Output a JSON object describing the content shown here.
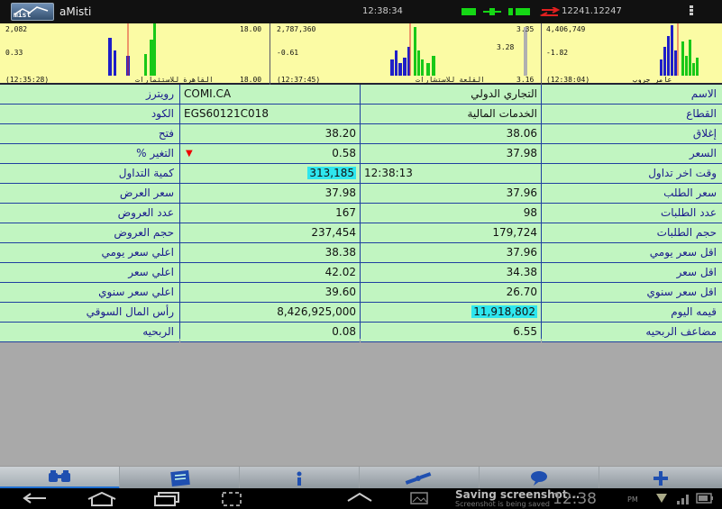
{
  "app": {
    "name": "aMisti",
    "logo_text": "mist",
    "logo_icon": "chart-line-icon"
  },
  "status": {
    "time": "12:38:34",
    "sequence": "12241.12247",
    "indicator_color": "#15d815",
    "transfer_color": "#e02020"
  },
  "mini_charts": [
    {
      "top_left": "2,082",
      "top_right": "18.00",
      "mid_left": "0.33",
      "bottom_left": "(12:35:28)",
      "bottom_right": "18.00",
      "name": "القاهرة للاستثمارات"
    },
    {
      "top_left": "2,787,360",
      "top_right": "3.35",
      "mid_left": "-0.61",
      "mid_right": "3.28",
      "bottom_left": "(12:37:45)",
      "bottom_right": "3.16",
      "name": "القلعة للاستشارات"
    },
    {
      "top_left": "4,406,749",
      "mid_left": "-1.82",
      "bottom_left": "(12:38:04)",
      "name": "عامر جروب"
    }
  ],
  "table": {
    "rows": [
      {
        "l_label": "رويترز",
        "l_value": "COMI.CA",
        "r_value": "التجاري الدولي",
        "r_label": "الاسم"
      },
      {
        "l_label": "الكود",
        "l_value": "EGS60121C018",
        "r_value": "الخدمات المالية",
        "r_label": "القطاع"
      },
      {
        "l_label": "فتح",
        "l_value": "38.20",
        "r_value": "38.06",
        "r_label": "إغلاق"
      },
      {
        "l_label": "% التغير",
        "l_value": "0.58",
        "r_value": "37.98",
        "r_label": "السعر"
      },
      {
        "l_label": "كمية التداول",
        "l_value": "313,185",
        "r_value": "12:38:13",
        "r_label": "وقت اخر تداول"
      },
      {
        "l_label": "سعر العرض",
        "l_value": "37.98",
        "r_value": "37.96",
        "r_label": "سعر الطلب"
      },
      {
        "l_label": "عدد العروض",
        "l_value": "167",
        "r_value": "98",
        "r_label": "عدد الطلبات"
      },
      {
        "l_label": "حجم العروض",
        "l_value": "237,454",
        "r_value": "179,724",
        "r_label": "حجم الطلبات"
      },
      {
        "l_label": "اعلي سعر يومي",
        "l_value": "38.38",
        "r_value": "37.96",
        "r_label": "اقل سعر يومي"
      },
      {
        "l_label": "اعلي سعر",
        "l_value": "42.02",
        "r_value": "34.38",
        "r_label": "اقل سعر"
      },
      {
        "l_label": "اعلي سعر سنوي",
        "l_value": "39.60",
        "r_value": "26.70",
        "r_label": "اقل سعر سنوي"
      },
      {
        "l_label": "رأس المال السوقي",
        "l_value": "8,426,925,000",
        "r_value": "11,918,802",
        "r_label": "قيمه اليوم"
      },
      {
        "l_label": "الربحيه",
        "l_value": "0.08",
        "r_value": "6.55",
        "r_label": "مضاعف الربحيه"
      }
    ]
  },
  "toolbar": {
    "items": [
      "binoculars-icon",
      "news-icon",
      "info-icon",
      "satellite-icon",
      "chat-icon",
      "add-icon"
    ],
    "active_index": 0,
    "accent": "#1f6fd1"
  },
  "navbar": {
    "saving_title": "Saving screenshot...",
    "saving_sub": "Screenshot is being saved",
    "time": "12:38",
    "ampm": "PM"
  }
}
